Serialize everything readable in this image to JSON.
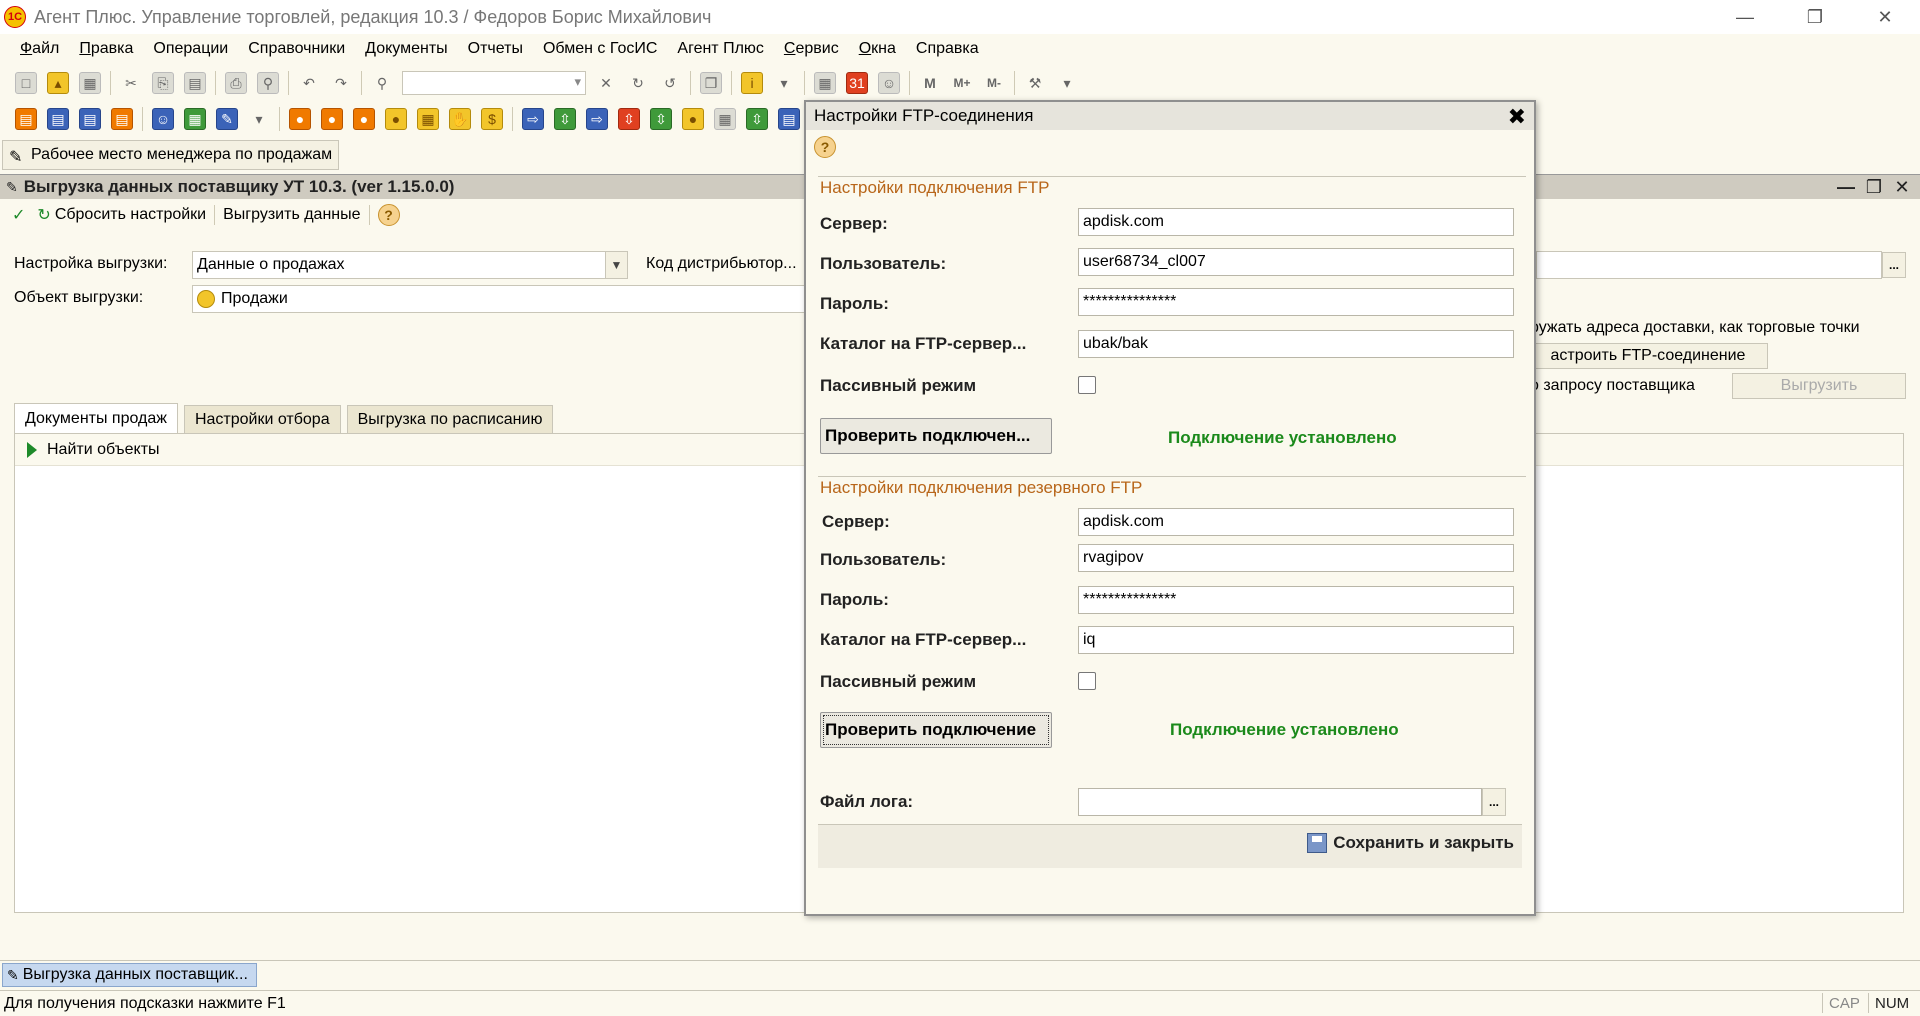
{
  "window": {
    "title": "Агент Плюс. Управление торговлей, редакция 10.3 / Федоров Борис Михайлович",
    "logo_text": "1С"
  },
  "menu": [
    "Файл",
    "Правка",
    "Операции",
    "Справочники",
    "Документы",
    "Отчеты",
    "Обмен с ГосИС",
    "Агент Плюс",
    "Сервис",
    "Окна",
    "Справка"
  ],
  "workplace_tab": "Рабочее место менеджера по продажам",
  "doc": {
    "title": "Выгрузка данных поставщику УТ 10.3. (ver 1.15.0.0)",
    "toolbar": {
      "reset": "Сбросить настройки",
      "export": "Выгрузить данные"
    },
    "export_setting_label": "Настройка выгрузки:",
    "export_setting_value": "Данные о продажах",
    "distributor_code_label": "Код дистрибьютор...",
    "export_object_label": "Объект выгрузки:",
    "export_object_value": "Продажи",
    "right_text_1": "ружать адреса доставки, как торговые точки",
    "configure_ftp_button": "астроить FTP-соединение",
    "right_text_2": "о запросу поставщика",
    "export_button": "Выгрузить",
    "tabs": [
      "Документы продаж",
      "Настройки отбора",
      "Выгрузка по расписанию"
    ],
    "find_objects": "Найти объекты"
  },
  "dialog": {
    "title": "Настройки FTP-соединения",
    "main_section": {
      "title": "Настройки подключения FTP",
      "server_label": "Сервер:",
      "server_value": "apdisk.com",
      "user_label": "Пользователь:",
      "user_value": "user68734_cl007",
      "password_label": "Пароль:",
      "password_value": "***************",
      "catalog_label": "Каталог на FTP-сервер...",
      "catalog_value": "ubak/bak",
      "passive_label": "Пассивный режим",
      "check_button": "Проверить подключен...",
      "status": "Подключение установлено"
    },
    "reserve_section": {
      "title": "Настройки подключения резервного FTP",
      "server_label": "Сервер:",
      "server_value": "apdisk.com",
      "user_label": "Пользователь:",
      "user_value": "rvagipov",
      "password_label": "Пароль:",
      "password_value": "***************",
      "catalog_label": "Каталог на FTP-сервер...",
      "catalog_value": "iq",
      "passive_label": "Пассивный режим",
      "check_button": "Проверить подключение",
      "status": "Подключение установлено"
    },
    "log_file_label": "Файл лога:",
    "log_file_value": "",
    "save_close": "Сохранить и закрыть"
  },
  "taskbar_item": "Выгрузка данных поставщик...",
  "status": {
    "hint": "Для получения подсказки нажмите F1",
    "cap": "CAP",
    "num": "NUM"
  },
  "colors": {
    "section_title": "#b8661a",
    "status_ok": "#1b8a1b",
    "window_bg": "#fbf9ee"
  }
}
